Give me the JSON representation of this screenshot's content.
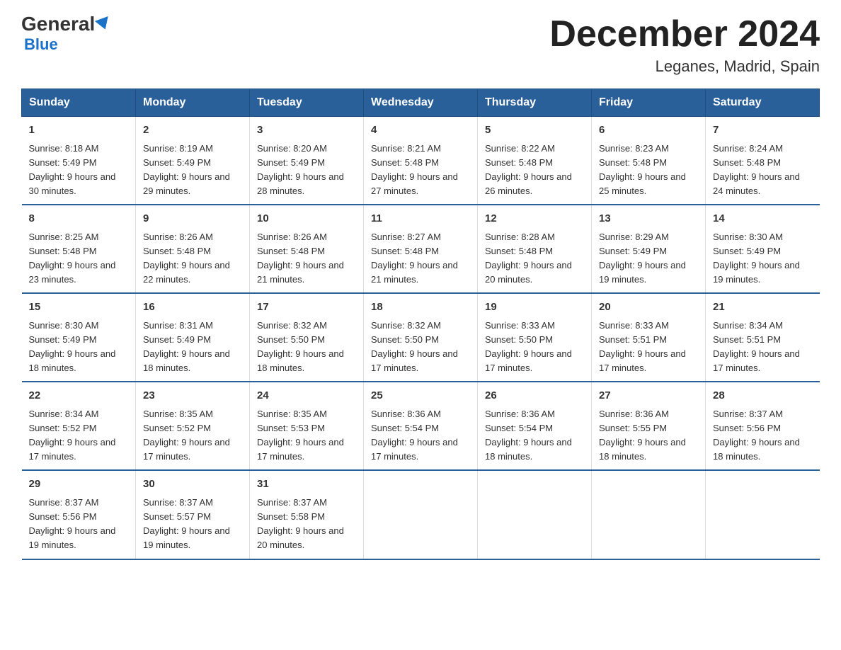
{
  "header": {
    "logo_general": "General",
    "logo_blue": "Blue",
    "title": "December 2024",
    "subtitle": "Leganes, Madrid, Spain"
  },
  "days_of_week": [
    "Sunday",
    "Monday",
    "Tuesday",
    "Wednesday",
    "Thursday",
    "Friday",
    "Saturday"
  ],
  "weeks": [
    [
      {
        "day": "1",
        "sunrise": "8:18 AM",
        "sunset": "5:49 PM",
        "daylight": "9 hours and 30 minutes."
      },
      {
        "day": "2",
        "sunrise": "8:19 AM",
        "sunset": "5:49 PM",
        "daylight": "9 hours and 29 minutes."
      },
      {
        "day": "3",
        "sunrise": "8:20 AM",
        "sunset": "5:49 PM",
        "daylight": "9 hours and 28 minutes."
      },
      {
        "day": "4",
        "sunrise": "8:21 AM",
        "sunset": "5:48 PM",
        "daylight": "9 hours and 27 minutes."
      },
      {
        "day": "5",
        "sunrise": "8:22 AM",
        "sunset": "5:48 PM",
        "daylight": "9 hours and 26 minutes."
      },
      {
        "day": "6",
        "sunrise": "8:23 AM",
        "sunset": "5:48 PM",
        "daylight": "9 hours and 25 minutes."
      },
      {
        "day": "7",
        "sunrise": "8:24 AM",
        "sunset": "5:48 PM",
        "daylight": "9 hours and 24 minutes."
      }
    ],
    [
      {
        "day": "8",
        "sunrise": "8:25 AM",
        "sunset": "5:48 PM",
        "daylight": "9 hours and 23 minutes."
      },
      {
        "day": "9",
        "sunrise": "8:26 AM",
        "sunset": "5:48 PM",
        "daylight": "9 hours and 22 minutes."
      },
      {
        "day": "10",
        "sunrise": "8:26 AM",
        "sunset": "5:48 PM",
        "daylight": "9 hours and 21 minutes."
      },
      {
        "day": "11",
        "sunrise": "8:27 AM",
        "sunset": "5:48 PM",
        "daylight": "9 hours and 21 minutes."
      },
      {
        "day": "12",
        "sunrise": "8:28 AM",
        "sunset": "5:48 PM",
        "daylight": "9 hours and 20 minutes."
      },
      {
        "day": "13",
        "sunrise": "8:29 AM",
        "sunset": "5:49 PM",
        "daylight": "9 hours and 19 minutes."
      },
      {
        "day": "14",
        "sunrise": "8:30 AM",
        "sunset": "5:49 PM",
        "daylight": "9 hours and 19 minutes."
      }
    ],
    [
      {
        "day": "15",
        "sunrise": "8:30 AM",
        "sunset": "5:49 PM",
        "daylight": "9 hours and 18 minutes."
      },
      {
        "day": "16",
        "sunrise": "8:31 AM",
        "sunset": "5:49 PM",
        "daylight": "9 hours and 18 minutes."
      },
      {
        "day": "17",
        "sunrise": "8:32 AM",
        "sunset": "5:50 PM",
        "daylight": "9 hours and 18 minutes."
      },
      {
        "day": "18",
        "sunrise": "8:32 AM",
        "sunset": "5:50 PM",
        "daylight": "9 hours and 17 minutes."
      },
      {
        "day": "19",
        "sunrise": "8:33 AM",
        "sunset": "5:50 PM",
        "daylight": "9 hours and 17 minutes."
      },
      {
        "day": "20",
        "sunrise": "8:33 AM",
        "sunset": "5:51 PM",
        "daylight": "9 hours and 17 minutes."
      },
      {
        "day": "21",
        "sunrise": "8:34 AM",
        "sunset": "5:51 PM",
        "daylight": "9 hours and 17 minutes."
      }
    ],
    [
      {
        "day": "22",
        "sunrise": "8:34 AM",
        "sunset": "5:52 PM",
        "daylight": "9 hours and 17 minutes."
      },
      {
        "day": "23",
        "sunrise": "8:35 AM",
        "sunset": "5:52 PM",
        "daylight": "9 hours and 17 minutes."
      },
      {
        "day": "24",
        "sunrise": "8:35 AM",
        "sunset": "5:53 PM",
        "daylight": "9 hours and 17 minutes."
      },
      {
        "day": "25",
        "sunrise": "8:36 AM",
        "sunset": "5:54 PM",
        "daylight": "9 hours and 17 minutes."
      },
      {
        "day": "26",
        "sunrise": "8:36 AM",
        "sunset": "5:54 PM",
        "daylight": "9 hours and 18 minutes."
      },
      {
        "day": "27",
        "sunrise": "8:36 AM",
        "sunset": "5:55 PM",
        "daylight": "9 hours and 18 minutes."
      },
      {
        "day": "28",
        "sunrise": "8:37 AM",
        "sunset": "5:56 PM",
        "daylight": "9 hours and 18 minutes."
      }
    ],
    [
      {
        "day": "29",
        "sunrise": "8:37 AM",
        "sunset": "5:56 PM",
        "daylight": "9 hours and 19 minutes."
      },
      {
        "day": "30",
        "sunrise": "8:37 AM",
        "sunset": "5:57 PM",
        "daylight": "9 hours and 19 minutes."
      },
      {
        "day": "31",
        "sunrise": "8:37 AM",
        "sunset": "5:58 PM",
        "daylight": "9 hours and 20 minutes."
      },
      null,
      null,
      null,
      null
    ]
  ]
}
